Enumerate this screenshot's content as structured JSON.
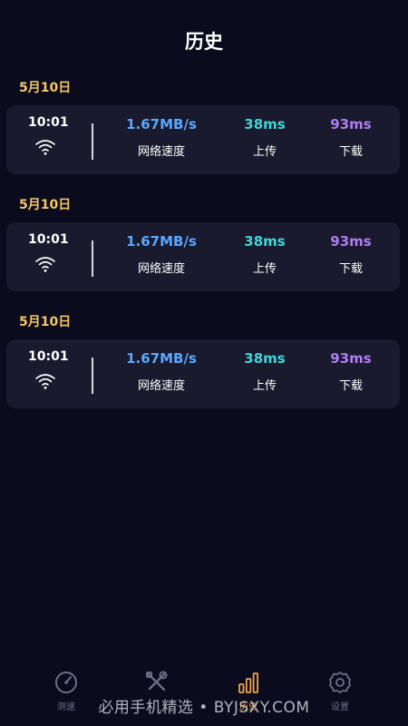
{
  "header": {
    "title": "历史"
  },
  "colors": {
    "background": "#0b0b1e",
    "card": "#191a2d",
    "date": "#f4c768",
    "speed": "#5aa7ff",
    "upload": "#3fd6d6",
    "download": "#b07cf0",
    "nav_active": "#f4a24a",
    "nav_inactive": "#6d6e84"
  },
  "history": [
    {
      "date": "5月10日",
      "time": "10:01",
      "network_icon": "wifi-icon",
      "speed_value": "1.67MB/s",
      "speed_label": "网络速度",
      "upload_value": "38ms",
      "upload_label": "上传",
      "download_value": "93ms",
      "download_label": "下载"
    },
    {
      "date": "5月10日",
      "time": "10:01",
      "network_icon": "wifi-icon",
      "speed_value": "1.67MB/s",
      "speed_label": "网络速度",
      "upload_value": "38ms",
      "upload_label": "上传",
      "download_value": "93ms",
      "download_label": "下载"
    },
    {
      "date": "5月10日",
      "time": "10:01",
      "network_icon": "wifi-icon",
      "speed_value": "1.67MB/s",
      "speed_label": "网络速度",
      "upload_value": "38ms",
      "upload_label": "上传",
      "download_value": "93ms",
      "download_label": "下载"
    }
  ],
  "nav": {
    "items": [
      {
        "label": "测速",
        "icon": "speedometer-icon",
        "active": false
      },
      {
        "label": "",
        "icon": "tools-icon",
        "active": false
      },
      {
        "label": "历史",
        "icon": "bar-chart-icon",
        "active": true
      },
      {
        "label": "设置",
        "icon": "gear-icon",
        "active": false
      }
    ]
  },
  "watermark": "必用手机精选 • BYJSXY.COM"
}
